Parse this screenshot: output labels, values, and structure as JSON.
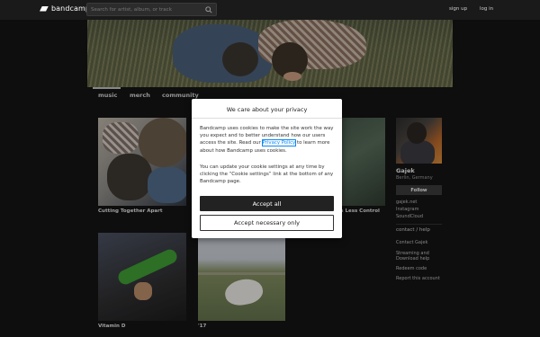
{
  "header": {
    "logo_text": "bandcamp",
    "search_placeholder": "Search for artist, album, or track",
    "sign_up": "sign up",
    "log_in": "log in"
  },
  "tabs": [
    {
      "label": "music",
      "active": true
    },
    {
      "label": "merch",
      "active": false
    },
    {
      "label": "community",
      "active": false
    }
  ],
  "albums": [
    {
      "title": "Cutting Together Apart"
    },
    {
      "title": "Vitamin D"
    },
    {
      "title": "'17"
    },
    {
      "title": "...s Less Control"
    }
  ],
  "artist": {
    "name": "Gajek",
    "location": "Berlin, Germany",
    "follow_label": "Follow",
    "links": [
      "gajek.net",
      "Instagram",
      "SoundCloud"
    ]
  },
  "sidebar_footer": {
    "header": "contact / help",
    "links": [
      "Contact Gajek",
      "Streaming and",
      "Download help",
      "Redeem code",
      "Report this account"
    ]
  },
  "cookie_modal": {
    "title": "We care about your privacy",
    "p1_before": "Bandcamp uses cookies to make the site work the way you expect and to better understand how our users access the site. Read our ",
    "privacy_link": "Privacy Policy",
    "p1_after": " to learn more about how Bandcamp uses cookies.",
    "p2": "You can update your cookie settings at any time by clicking the “Cookie settings” link at the bottom of any Bandcamp page.",
    "accept_all": "Accept all",
    "accept_necessary": "Accept necessary only"
  },
  "colors": {
    "background": "#141414",
    "topbar": "#1a1a1a",
    "link_blue": "#0687f5",
    "accept_button": "#222222"
  }
}
